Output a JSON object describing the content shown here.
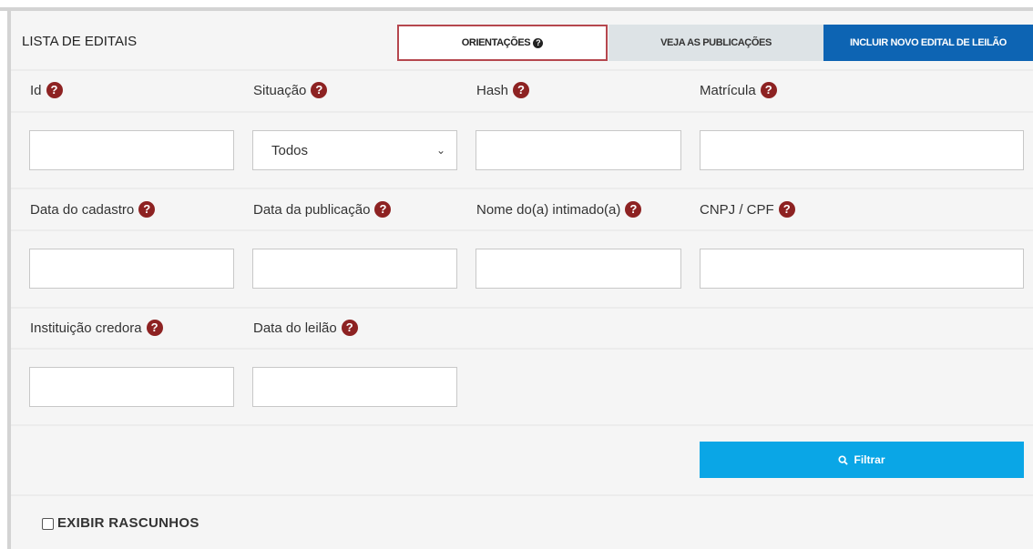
{
  "header": {
    "title": "LISTA DE EDITAIS",
    "tabs": {
      "orientacoes": "ORIENTAÇÕES",
      "publicacoes": "VEJA AS PUBLICAÇÕES",
      "incluir": "INCLUIR NOVO EDITAL DE LEILÃO"
    }
  },
  "filters": {
    "id": {
      "label": "Id",
      "value": ""
    },
    "situacao": {
      "label": "Situação",
      "selected": "Todos"
    },
    "hash": {
      "label": "Hash",
      "value": ""
    },
    "matricula": {
      "label": "Matrícula",
      "value": ""
    },
    "data_cadastro": {
      "label": "Data do cadastro",
      "value": ""
    },
    "data_publicacao": {
      "label": "Data da publicação",
      "value": ""
    },
    "nome_intimado": {
      "label": "Nome do(a) intimado(a)",
      "value": ""
    },
    "cnpj_cpf": {
      "label": "CNPJ / CPF",
      "value": ""
    },
    "instituicao_credora": {
      "label": "Instituição credora",
      "value": ""
    },
    "data_leilao": {
      "label": "Data do leilão",
      "value": ""
    }
  },
  "actions": {
    "filter_label": "Filtrar"
  },
  "options": {
    "show_drafts_label": "EXIBIR RASCUNHOS"
  },
  "colors": {
    "primary": "#0d64b3",
    "filter": "#0aa6e6",
    "help_icon": "#8d2222",
    "orient_border": "#b5474e"
  },
  "icons": {
    "help": "question-circle-icon",
    "search": "search-icon",
    "select": "chevron-down-icon"
  }
}
